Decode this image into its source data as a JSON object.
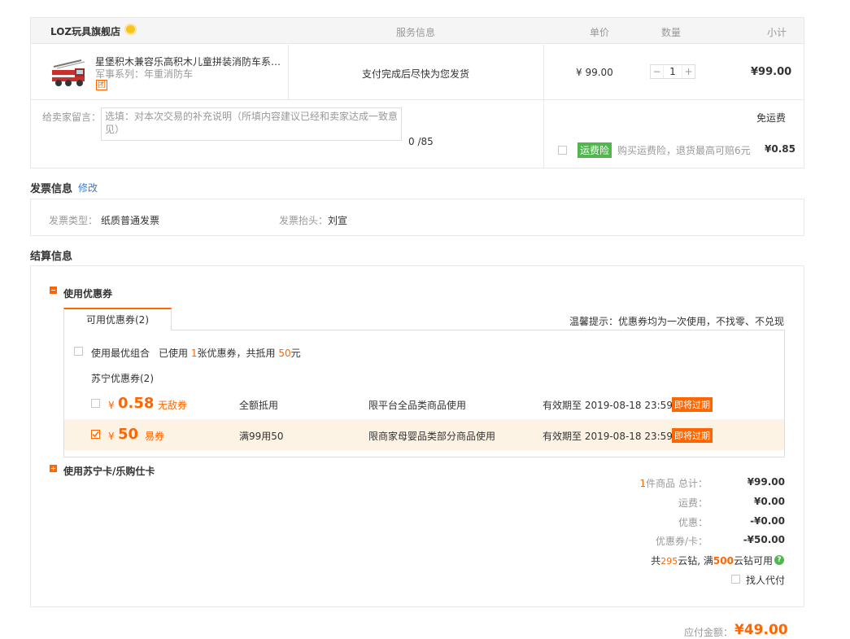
{
  "shop": {
    "name": "LOZ玩具旗舰店"
  },
  "header": {
    "service": "服务信息",
    "unit_price": "单价",
    "quantity": "数量",
    "subtotal": "小计"
  },
  "item": {
    "title": "星堡积木兼容乐高积木儿童拼装消防车系…",
    "series": "军事系列：年重消防车",
    "badge": "团",
    "service": "支付完成后尽快为您发货",
    "price": "¥ 99.00",
    "qty": "1",
    "qty_minus": "−",
    "qty_plus": "+",
    "subtotal": "¥99.00"
  },
  "message": {
    "label": "给卖家留言：",
    "placeholder": "选填：对本次交易的补充说明（所填内容建议已经和卖家达成一致意见）",
    "counter": "0 /85"
  },
  "shipping": {
    "free": "免运费",
    "insurance_tag": "运费险",
    "insurance_text": "购买运费险，退货最高可赔6元",
    "insurance_price": "¥0.85"
  },
  "invoice": {
    "title": "发票信息",
    "edit": "修改",
    "type_label": "发票类型：",
    "type_value": "纸质普通发票",
    "head_label": "发票抬头：",
    "head_value": "刘宣"
  },
  "settlement": {
    "title": "结算信息",
    "coupon_section": "使用优惠券",
    "tab": "可用优惠券(2)",
    "tip": "温馨提示：优惠券均为一次使用，不找零、不兑现",
    "best_combo": "使用最优组合",
    "used_prefix": "已使用",
    "used_count": "1",
    "used_mid": "张优惠券，共抵用",
    "used_amount": "50",
    "used_suffix": "元",
    "group_label": "苏宁优惠券(2)",
    "coupons": [
      {
        "symbol": "¥",
        "amount": "0.58",
        "kind": "无敌券",
        "rule": "全额抵用",
        "scope": "限平台全品类商品使用",
        "expiry": "有效期至 2019-08-18 23:59",
        "flag": "即将过期"
      },
      {
        "symbol": "¥",
        "amount": "50",
        "kind": "易券",
        "rule": "满99用50",
        "scope": "限商家母婴品类部分商品使用",
        "expiry": "有效期至 2019-08-18 23:59",
        "flag": "即将过期"
      }
    ],
    "card_section": "使用苏宁卡/乐购仕卡"
  },
  "summary": {
    "count": "1",
    "count_label": "件商品 总计：",
    "total": "¥99.00",
    "freight_label": "运费：",
    "freight": "¥0.00",
    "discount_label": "优惠：",
    "discount": "-¥0.00",
    "coupon_label": "优惠券/卡：",
    "coupon": "-¥50.00",
    "cloud_prefix": "共",
    "cloud_have": "295",
    "cloud_mid": "云钻, 满",
    "cloud_need": "500",
    "cloud_suffix": "云钻可用",
    "help_icon": "?",
    "proxy_pay": "找人代付",
    "payable_label": "应付金额：",
    "payable": "¥49.00"
  },
  "colors": {
    "accent": "#ff6600",
    "insurance_green": "#52b64f",
    "link_blue": "#3b7bd6",
    "coupon_selected_bg": "#fdf3e4"
  }
}
